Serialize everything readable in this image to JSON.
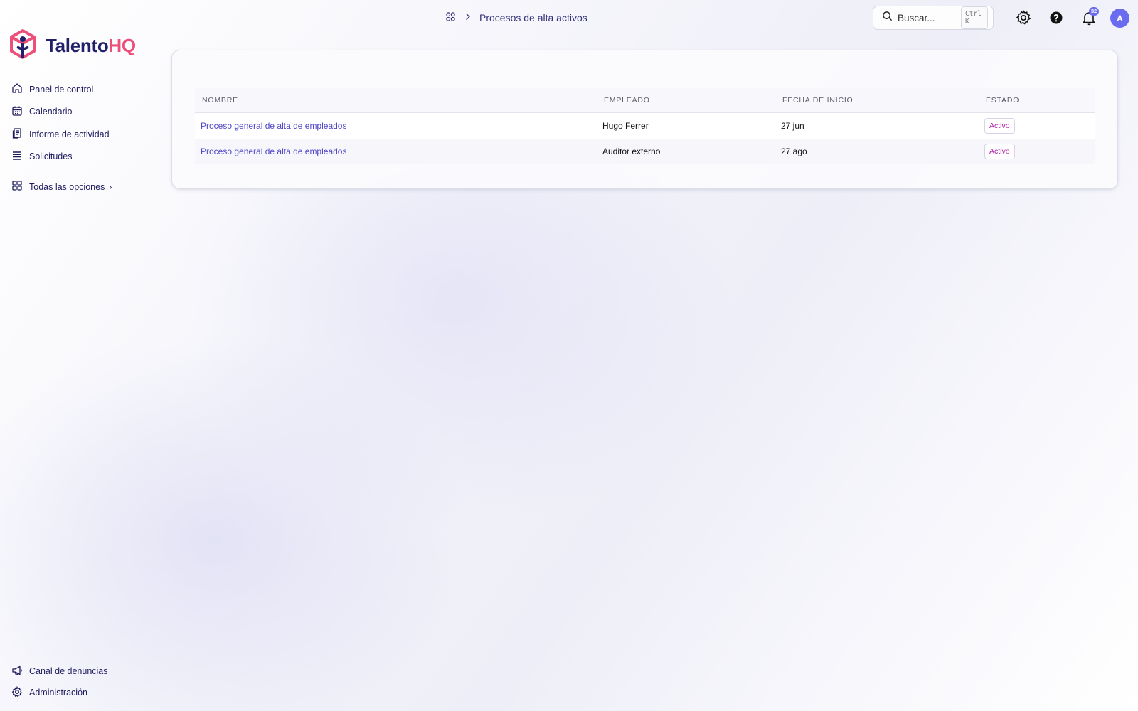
{
  "brand": {
    "name_part1": "Talento",
    "name_part2": "HQ"
  },
  "sidebar": {
    "items": [
      {
        "label": "Panel de control",
        "icon": "home-icon"
      },
      {
        "label": "Calendario",
        "icon": "calendar-icon"
      },
      {
        "label": "Informe de actividad",
        "icon": "report-icon"
      },
      {
        "label": "Solicitudes",
        "icon": "list-icon"
      }
    ],
    "all_options": {
      "label": "Todas las opciones",
      "icon": "grid-icon"
    },
    "bottom_items": [
      {
        "label": "Canal de denuncias",
        "icon": "megaphone-icon"
      },
      {
        "label": "Administración",
        "icon": "gear-icon"
      }
    ]
  },
  "header": {
    "breadcrumb_current": "Procesos de alta activos",
    "search": {
      "placeholder": "Buscar...",
      "shortcut": "Ctrl K"
    },
    "notifications_count": "32",
    "avatar_initial": "A"
  },
  "table": {
    "columns": [
      "NOMBRE",
      "EMPLEADO",
      "FECHA DE INICIO",
      "ESTADO"
    ],
    "rows": [
      {
        "name": "Proceso general de alta de empleados",
        "employee": "Hugo Ferrer",
        "start_date": "27 jun",
        "status": "Activo"
      },
      {
        "name": "Proceso general de alta de empleados",
        "employee": "Auditor externo",
        "start_date": "27 ago",
        "status": "Activo"
      }
    ]
  },
  "colors": {
    "brand_navy": "#22206b",
    "brand_pink": "#ec4f79",
    "accent": "#6b6bf0",
    "link": "#4f46c8",
    "status_text": "#b020a8"
  }
}
